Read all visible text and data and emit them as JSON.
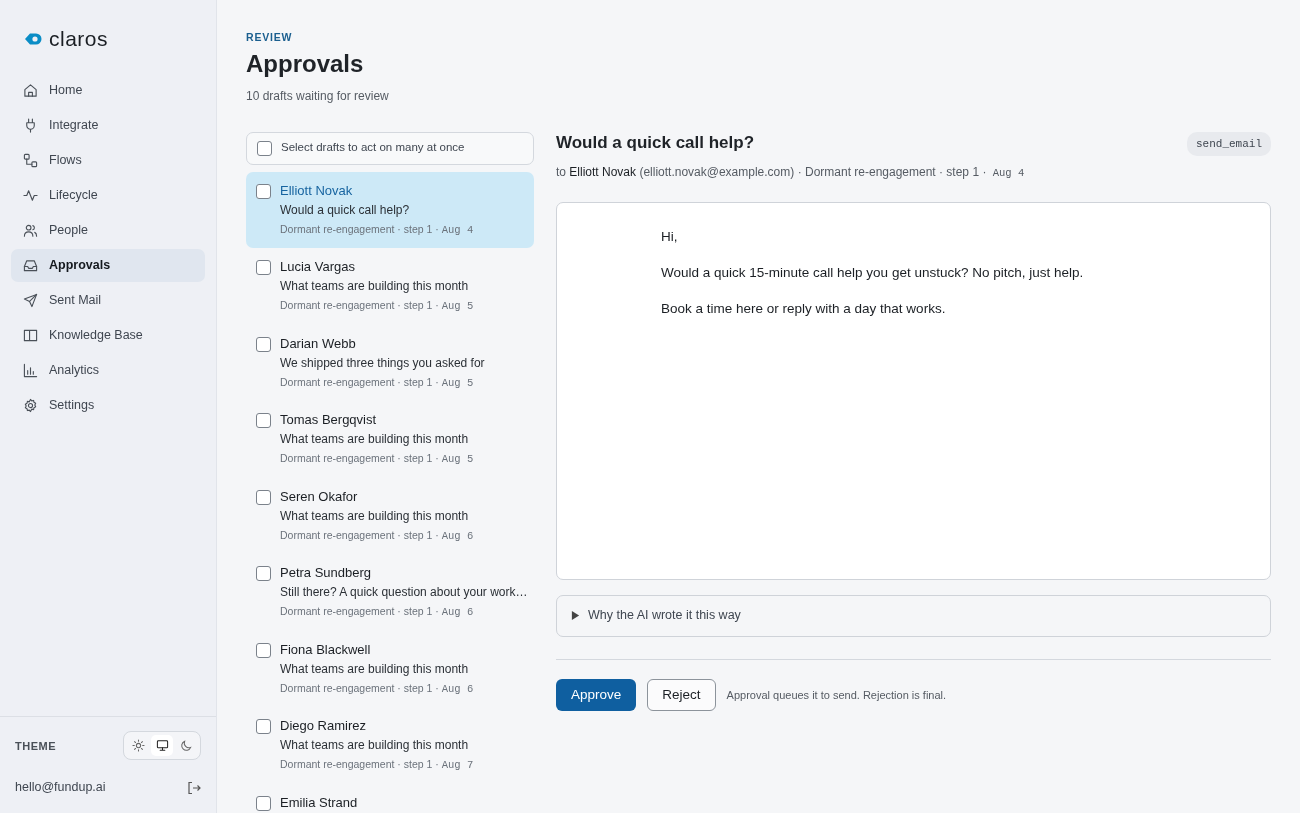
{
  "brand": {
    "name": "claros"
  },
  "nav": [
    {
      "label": "Home",
      "selected": false
    },
    {
      "label": "Integrate",
      "selected": false
    },
    {
      "label": "Flows",
      "selected": false
    },
    {
      "label": "Lifecycle",
      "selected": false
    },
    {
      "label": "People",
      "selected": false
    },
    {
      "label": "Approvals",
      "selected": true
    },
    {
      "label": "Sent Mail",
      "selected": false
    },
    {
      "label": "Knowledge Base",
      "selected": false
    },
    {
      "label": "Analytics",
      "selected": false
    },
    {
      "label": "Settings",
      "selected": false
    }
  ],
  "theme": {
    "label": "THEME",
    "options": [
      {
        "kind": "light",
        "selected": false
      },
      {
        "kind": "system",
        "selected": true
      },
      {
        "kind": "dark",
        "selected": false
      }
    ]
  },
  "account": {
    "email": "hello@fundup.ai"
  },
  "header": {
    "eyebrow": "REVIEW",
    "title": "Approvals",
    "subtitle": "10 drafts waiting for review"
  },
  "bulk_select": {
    "label": "Select drafts to act on many at once",
    "checked": false
  },
  "drafts": [
    {
      "name": "Elliott Novak",
      "subject": "Would a quick call help?",
      "sequence": "Dormant re-engagement · step 1 ·",
      "date": "Aug 4",
      "selected": true,
      "checked": false
    },
    {
      "name": "Lucia Vargas",
      "subject": "What teams are building this month",
      "sequence": "Dormant re-engagement · step 1 ·",
      "date": "Aug 5",
      "selected": false,
      "checked": false
    },
    {
      "name": "Darian Webb",
      "subject": "We shipped three things you asked for",
      "sequence": "Dormant re-engagement · step 1 ·",
      "date": "Aug 5",
      "selected": false,
      "checked": false
    },
    {
      "name": "Tomas Bergqvist",
      "subject": "What teams are building this month",
      "sequence": "Dormant re-engagement · step 1 ·",
      "date": "Aug 5",
      "selected": false,
      "checked": false
    },
    {
      "name": "Seren Okafor",
      "subject": "What teams are building this month",
      "sequence": "Dormant re-engagement · step 1 ·",
      "date": "Aug 6",
      "selected": false,
      "checked": false
    },
    {
      "name": "Petra Sundberg",
      "subject": "Still there? A quick question about your work…",
      "sequence": "Dormant re-engagement · step 1 ·",
      "date": "Aug 6",
      "selected": false,
      "checked": false
    },
    {
      "name": "Fiona Blackwell",
      "subject": "What teams are building this month",
      "sequence": "Dormant re-engagement · step 1 ·",
      "date": "Aug 6",
      "selected": false,
      "checked": false
    },
    {
      "name": "Diego Ramirez",
      "subject": "What teams are building this month",
      "sequence": "Dormant re-engagement · step 1 ·",
      "date": "Aug 7",
      "selected": false,
      "checked": false
    },
    {
      "name": "Emilia Strand",
      "selected": false,
      "checked": false
    }
  ],
  "detail": {
    "subject": "Would a quick call help?",
    "action_tag": "send_email",
    "to_label": "to",
    "recipient": "Elliott Novak",
    "email": "(elliott.novak@example.com)",
    "sequence": "· Dormant re-engagement · step 1 ·",
    "date": "Aug 4",
    "body": [
      "Hi,",
      "Would a quick 15-minute call help you get unstuck? No pitch, just help.",
      "Book a time here or reply with a day that works."
    ],
    "reasoning": {
      "label": "Why the AI wrote it this way",
      "expanded": false
    },
    "approve": "Approve",
    "reject": "Reject",
    "note": "Approval queues it to send. Rejection is final."
  }
}
